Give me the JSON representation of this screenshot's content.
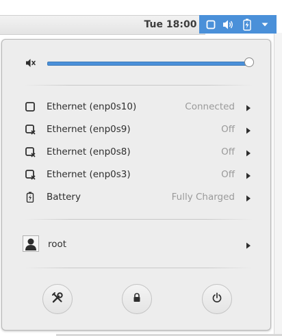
{
  "topbar": {
    "clock": "Tue 18:00",
    "indicators": [
      {
        "icon": "network-wired-icon"
      },
      {
        "icon": "volume-icon"
      },
      {
        "icon": "battery-charged-icon"
      },
      {
        "icon": "dropdown-arrow-icon"
      }
    ]
  },
  "colors": {
    "accent": "#4a90d9",
    "panel_bg": "#ededed",
    "text": "#2e2e2e",
    "muted_text": "#9a9a9a"
  },
  "volume": {
    "icon": "volume-muted-icon",
    "level": 1.0
  },
  "network_items": [
    {
      "label": "Ethernet (enp0s10)",
      "status": "Connected",
      "icon": "network-wired-icon"
    },
    {
      "label": "Ethernet (enp0s9)",
      "status": "Off",
      "icon": "network-wired-disconnected-icon"
    },
    {
      "label": "Ethernet (enp0s8)",
      "status": "Off",
      "icon": "network-wired-disconnected-icon"
    },
    {
      "label": "Ethernet (enp0s3)",
      "status": "Off",
      "icon": "network-wired-disconnected-icon"
    },
    {
      "label": "Battery",
      "status": "Fully Charged",
      "icon": "battery-charged-icon"
    }
  ],
  "user": {
    "name": "root",
    "icon": "avatar-icon"
  },
  "actions": [
    {
      "name": "settings-button",
      "icon": "settings-tools-icon"
    },
    {
      "name": "lock-button",
      "icon": "lock-icon"
    },
    {
      "name": "power-button",
      "icon": "power-icon"
    }
  ]
}
